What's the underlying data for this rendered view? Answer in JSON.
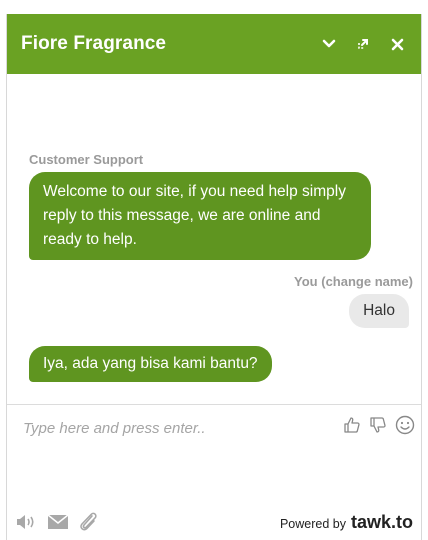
{
  "header": {
    "title": "Fiore Fragrance",
    "bg_color": "#6aa223"
  },
  "messages": {
    "agent_name": "Customer Support",
    "agent_first": "Welcome to our site, if you need help simply reply to this message, we are online and ready to help.",
    "you_label": "You",
    "you_change": "(change name)",
    "you_message": "Halo",
    "agent_second": "Iya, ada yang bisa kami bantu?"
  },
  "composer": {
    "placeholder": "Type here and press enter.."
  },
  "footer": {
    "powered_by": "Powered by",
    "brand": "tawk.to"
  },
  "colors": {
    "agent_bubble": "#5f9520",
    "visitor_bubble": "#e9e9e9"
  },
  "icons": {
    "header": [
      "chevron-down-icon",
      "popout-icon",
      "close-icon"
    ],
    "reactions": [
      "thumbs-up-icon",
      "thumbs-down-icon",
      "smiley-icon"
    ],
    "footer": [
      "sound-icon",
      "email-icon",
      "paperclip-icon"
    ]
  }
}
